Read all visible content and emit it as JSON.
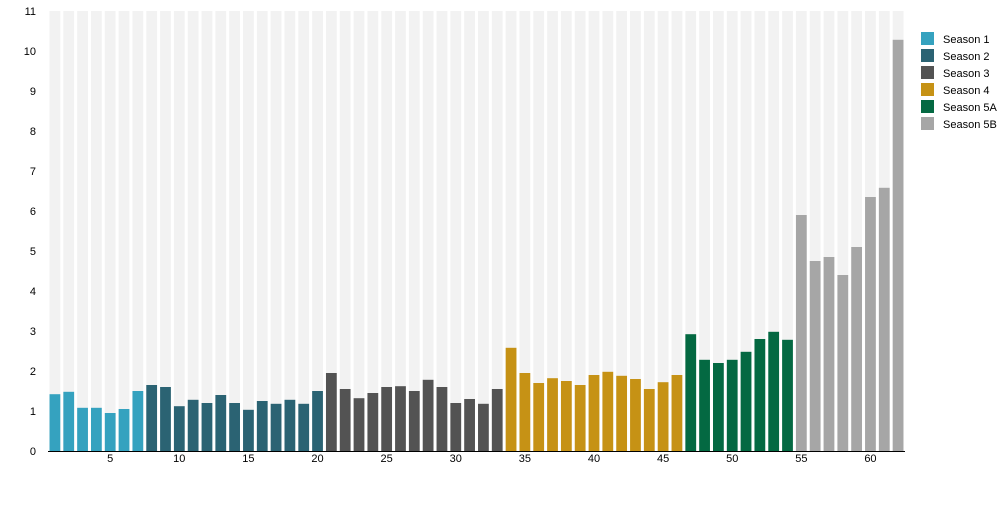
{
  "chart_data": {
    "type": "bar",
    "title": "",
    "xlabel": "",
    "ylabel": "",
    "ylim": [
      0,
      11
    ],
    "y_ticks": [
      0,
      1,
      2,
      3,
      4,
      5,
      6,
      7,
      8,
      9,
      10,
      11
    ],
    "x_ticks": [
      5,
      10,
      15,
      20,
      25,
      30,
      35,
      40,
      45,
      50,
      55,
      60
    ],
    "grid": "vertical background stripes behind each episode slot",
    "legend_position": "right",
    "series": [
      {
        "name": "Season 1",
        "color": "#35a2bf",
        "x": [
          1,
          2,
          3,
          4,
          5,
          6,
          7
        ],
        "values": [
          1.42,
          1.48,
          1.08,
          1.08,
          0.95,
          1.05,
          1.5
        ]
      },
      {
        "name": "Season 2",
        "color": "#2b6373",
        "x": [
          8,
          9,
          10,
          11,
          12,
          13,
          14,
          15,
          16,
          17,
          18,
          19,
          20
        ],
        "values": [
          1.65,
          1.6,
          1.12,
          1.28,
          1.2,
          1.4,
          1.2,
          1.03,
          1.25,
          1.18,
          1.28,
          1.18,
          1.5
        ]
      },
      {
        "name": "Season 3",
        "color": "#535353",
        "x": [
          21,
          22,
          23,
          24,
          25,
          26,
          27,
          28,
          29,
          30,
          31,
          32,
          33
        ],
        "values": [
          1.95,
          1.55,
          1.32,
          1.45,
          1.6,
          1.62,
          1.5,
          1.78,
          1.6,
          1.2,
          1.3,
          1.18,
          1.55
        ]
      },
      {
        "name": "Season 4",
        "color": "#c69215",
        "x": [
          34,
          35,
          36,
          37,
          38,
          39,
          40,
          41,
          42,
          43,
          44,
          45,
          46
        ],
        "values": [
          2.58,
          1.95,
          1.7,
          1.82,
          1.75,
          1.65,
          1.9,
          1.98,
          1.88,
          1.8,
          1.55,
          1.72,
          1.9
        ]
      },
      {
        "name": "Season 5A",
        "color": "#046942",
        "x": [
          47,
          48,
          49,
          50,
          51,
          52,
          53,
          54
        ],
        "values": [
          2.92,
          2.28,
          2.2,
          2.28,
          2.48,
          2.8,
          2.98,
          2.78
        ]
      },
      {
        "name": "Season 5B",
        "color": "#a6a6a6",
        "x": [
          55,
          56,
          57,
          58,
          59,
          60,
          61,
          62
        ],
        "values": [
          5.9,
          4.75,
          4.85,
          4.4,
          5.1,
          6.35,
          6.58,
          10.28
        ]
      }
    ]
  }
}
